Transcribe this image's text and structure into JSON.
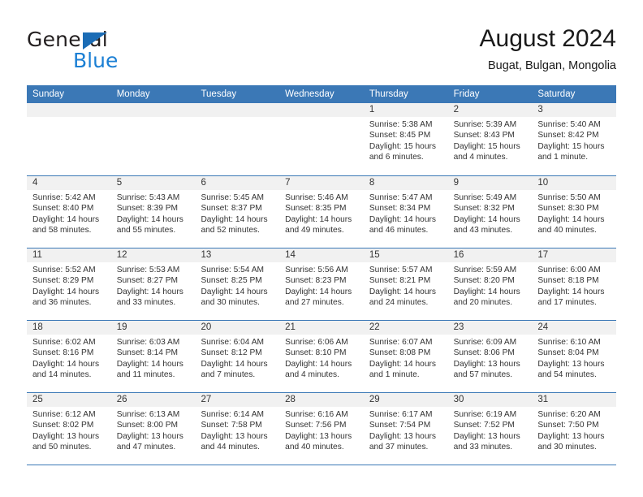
{
  "brand": {
    "name_part1": "General",
    "name_part2": "Blue",
    "flag_icon": "triangle-flag-icon"
  },
  "header": {
    "title": "August 2024",
    "location": "Bugat, Bulgan, Mongolia"
  },
  "colors": {
    "header_blue": "#3b78b6",
    "brand_blue": "#1b7fd4",
    "daynum_strip": "#f1f1f1",
    "text": "#333333"
  },
  "weekdays": [
    "Sunday",
    "Monday",
    "Tuesday",
    "Wednesday",
    "Thursday",
    "Friday",
    "Saturday"
  ],
  "labels": {
    "sunrise_prefix": "Sunrise:",
    "sunset_prefix": "Sunset:",
    "daylight_prefix": "Daylight:"
  },
  "weeks": [
    [
      {
        "day": "",
        "empty": true
      },
      {
        "day": "",
        "empty": true
      },
      {
        "day": "",
        "empty": true
      },
      {
        "day": "",
        "empty": true
      },
      {
        "day": "1",
        "sunrise": "Sunrise: 5:38 AM",
        "sunset": "Sunset: 8:45 PM",
        "daylight": "Daylight: 15 hours and 6 minutes."
      },
      {
        "day": "2",
        "sunrise": "Sunrise: 5:39 AM",
        "sunset": "Sunset: 8:43 PM",
        "daylight": "Daylight: 15 hours and 4 minutes."
      },
      {
        "day": "3",
        "sunrise": "Sunrise: 5:40 AM",
        "sunset": "Sunset: 8:42 PM",
        "daylight": "Daylight: 15 hours and 1 minute."
      }
    ],
    [
      {
        "day": "4",
        "sunrise": "Sunrise: 5:42 AM",
        "sunset": "Sunset: 8:40 PM",
        "daylight": "Daylight: 14 hours and 58 minutes."
      },
      {
        "day": "5",
        "sunrise": "Sunrise: 5:43 AM",
        "sunset": "Sunset: 8:39 PM",
        "daylight": "Daylight: 14 hours and 55 minutes."
      },
      {
        "day": "6",
        "sunrise": "Sunrise: 5:45 AM",
        "sunset": "Sunset: 8:37 PM",
        "daylight": "Daylight: 14 hours and 52 minutes."
      },
      {
        "day": "7",
        "sunrise": "Sunrise: 5:46 AM",
        "sunset": "Sunset: 8:35 PM",
        "daylight": "Daylight: 14 hours and 49 minutes."
      },
      {
        "day": "8",
        "sunrise": "Sunrise: 5:47 AM",
        "sunset": "Sunset: 8:34 PM",
        "daylight": "Daylight: 14 hours and 46 minutes."
      },
      {
        "day": "9",
        "sunrise": "Sunrise: 5:49 AM",
        "sunset": "Sunset: 8:32 PM",
        "daylight": "Daylight: 14 hours and 43 minutes."
      },
      {
        "day": "10",
        "sunrise": "Sunrise: 5:50 AM",
        "sunset": "Sunset: 8:30 PM",
        "daylight": "Daylight: 14 hours and 40 minutes."
      }
    ],
    [
      {
        "day": "11",
        "sunrise": "Sunrise: 5:52 AM",
        "sunset": "Sunset: 8:29 PM",
        "daylight": "Daylight: 14 hours and 36 minutes."
      },
      {
        "day": "12",
        "sunrise": "Sunrise: 5:53 AM",
        "sunset": "Sunset: 8:27 PM",
        "daylight": "Daylight: 14 hours and 33 minutes."
      },
      {
        "day": "13",
        "sunrise": "Sunrise: 5:54 AM",
        "sunset": "Sunset: 8:25 PM",
        "daylight": "Daylight: 14 hours and 30 minutes."
      },
      {
        "day": "14",
        "sunrise": "Sunrise: 5:56 AM",
        "sunset": "Sunset: 8:23 PM",
        "daylight": "Daylight: 14 hours and 27 minutes."
      },
      {
        "day": "15",
        "sunrise": "Sunrise: 5:57 AM",
        "sunset": "Sunset: 8:21 PM",
        "daylight": "Daylight: 14 hours and 24 minutes."
      },
      {
        "day": "16",
        "sunrise": "Sunrise: 5:59 AM",
        "sunset": "Sunset: 8:20 PM",
        "daylight": "Daylight: 14 hours and 20 minutes."
      },
      {
        "day": "17",
        "sunrise": "Sunrise: 6:00 AM",
        "sunset": "Sunset: 8:18 PM",
        "daylight": "Daylight: 14 hours and 17 minutes."
      }
    ],
    [
      {
        "day": "18",
        "sunrise": "Sunrise: 6:02 AM",
        "sunset": "Sunset: 8:16 PM",
        "daylight": "Daylight: 14 hours and 14 minutes."
      },
      {
        "day": "19",
        "sunrise": "Sunrise: 6:03 AM",
        "sunset": "Sunset: 8:14 PM",
        "daylight": "Daylight: 14 hours and 11 minutes."
      },
      {
        "day": "20",
        "sunrise": "Sunrise: 6:04 AM",
        "sunset": "Sunset: 8:12 PM",
        "daylight": "Daylight: 14 hours and 7 minutes."
      },
      {
        "day": "21",
        "sunrise": "Sunrise: 6:06 AM",
        "sunset": "Sunset: 8:10 PM",
        "daylight": "Daylight: 14 hours and 4 minutes."
      },
      {
        "day": "22",
        "sunrise": "Sunrise: 6:07 AM",
        "sunset": "Sunset: 8:08 PM",
        "daylight": "Daylight: 14 hours and 1 minute."
      },
      {
        "day": "23",
        "sunrise": "Sunrise: 6:09 AM",
        "sunset": "Sunset: 8:06 PM",
        "daylight": "Daylight: 13 hours and 57 minutes."
      },
      {
        "day": "24",
        "sunrise": "Sunrise: 6:10 AM",
        "sunset": "Sunset: 8:04 PM",
        "daylight": "Daylight: 13 hours and 54 minutes."
      }
    ],
    [
      {
        "day": "25",
        "sunrise": "Sunrise: 6:12 AM",
        "sunset": "Sunset: 8:02 PM",
        "daylight": "Daylight: 13 hours and 50 minutes."
      },
      {
        "day": "26",
        "sunrise": "Sunrise: 6:13 AM",
        "sunset": "Sunset: 8:00 PM",
        "daylight": "Daylight: 13 hours and 47 minutes."
      },
      {
        "day": "27",
        "sunrise": "Sunrise: 6:14 AM",
        "sunset": "Sunset: 7:58 PM",
        "daylight": "Daylight: 13 hours and 44 minutes."
      },
      {
        "day": "28",
        "sunrise": "Sunrise: 6:16 AM",
        "sunset": "Sunset: 7:56 PM",
        "daylight": "Daylight: 13 hours and 40 minutes."
      },
      {
        "day": "29",
        "sunrise": "Sunrise: 6:17 AM",
        "sunset": "Sunset: 7:54 PM",
        "daylight": "Daylight: 13 hours and 37 minutes."
      },
      {
        "day": "30",
        "sunrise": "Sunrise: 6:19 AM",
        "sunset": "Sunset: 7:52 PM",
        "daylight": "Daylight: 13 hours and 33 minutes."
      },
      {
        "day": "31",
        "sunrise": "Sunrise: 6:20 AM",
        "sunset": "Sunset: 7:50 PM",
        "daylight": "Daylight: 13 hours and 30 minutes."
      }
    ]
  ]
}
